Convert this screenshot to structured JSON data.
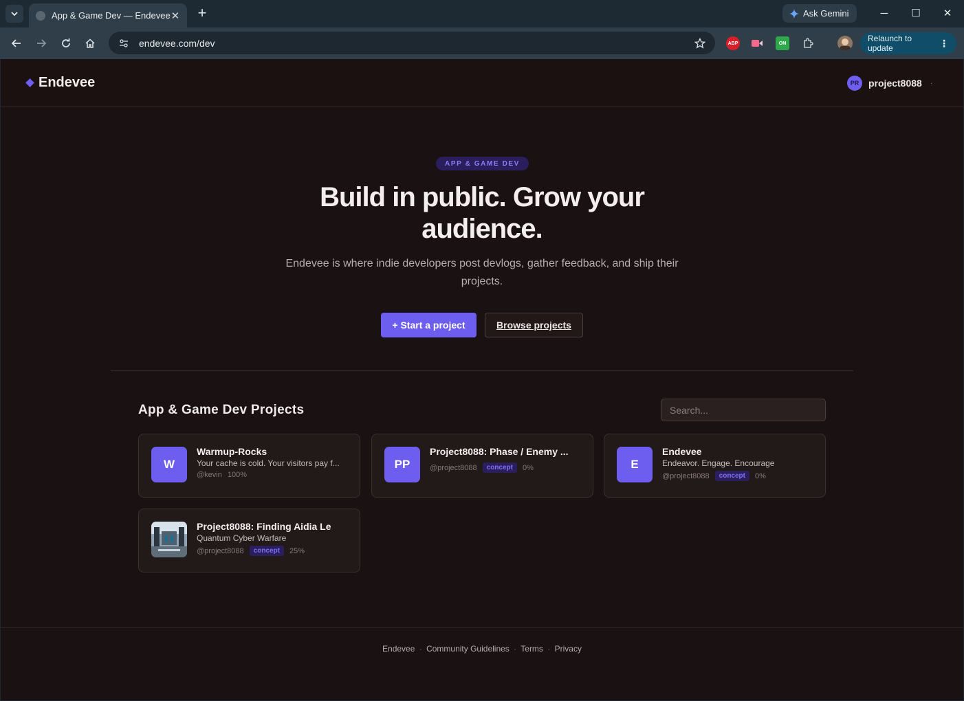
{
  "browser": {
    "tab_title": "App & Game Dev — Endevee",
    "gemini_label": "Ask Gemini",
    "url": "endevee.com/dev",
    "relaunch_label": "Relaunch to update",
    "ext_abp": "ABP",
    "ext_on": "ON"
  },
  "header": {
    "brand": "Endevee",
    "user_initials": "PR",
    "user_name": "project8088",
    "user_caret": "·"
  },
  "hero": {
    "badge": "APP & GAME DEV",
    "title_line1": "Build in public. Grow your",
    "title_line2": "audience.",
    "subtitle_line1": "Endevee is where indie developers post devlogs, gather feedback, and ship their",
    "subtitle_line2": "projects.",
    "primary_button": "+ Start a project",
    "secondary_button": "Browse projects"
  },
  "projects": {
    "section_title": "App & Game Dev Projects",
    "search_placeholder": "Search...",
    "items": [
      {
        "thumb": "W",
        "title": "Warmup-Rocks",
        "tagline": "Your cache is cold. Your visitors pay f...",
        "author": "@kevin",
        "stage": "",
        "progress": "100%"
      },
      {
        "thumb": "PP",
        "title": "Project8088: Phase / Enemy ...",
        "tagline": "",
        "author": "@project8088",
        "stage": "concept",
        "progress": "0%"
      },
      {
        "thumb": "E",
        "title": "Endevee",
        "tagline": "Endeavor. Engage. Encourage",
        "author": "@project8088",
        "stage": "concept",
        "progress": "0%"
      },
      {
        "thumb": "",
        "title": "Project8088: Finding Aidia Le",
        "tagline": "Quantum Cyber Warfare",
        "author": "@project8088",
        "stage": "concept",
        "progress": "25%"
      }
    ]
  },
  "footer": {
    "links": [
      "Endevee",
      "Community Guidelines",
      "Terms",
      "Privacy"
    ],
    "separator": "·"
  },
  "colors": {
    "accent": "#6d5ef0",
    "page_bg": "#1a1212",
    "chrome_bg": "#2f3e49"
  }
}
